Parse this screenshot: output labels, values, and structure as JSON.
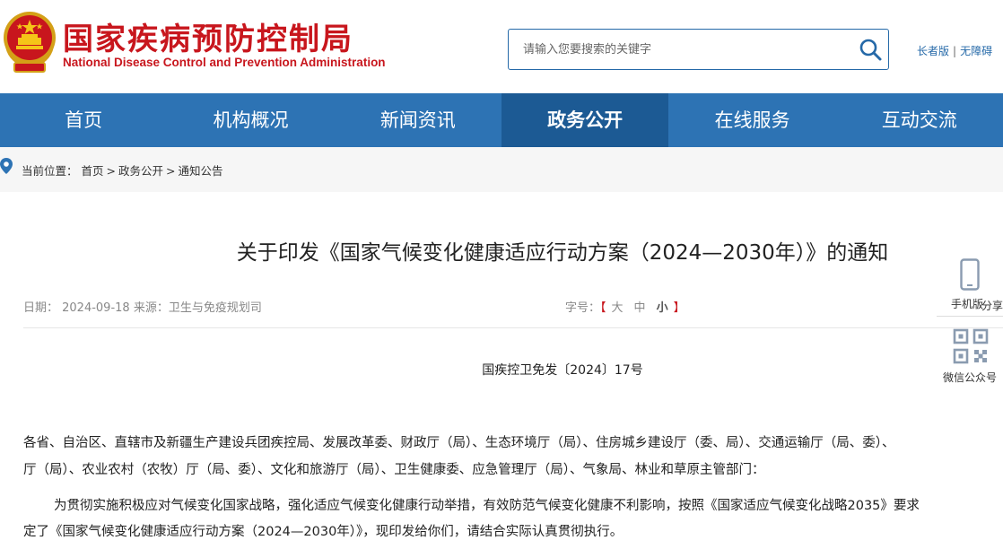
{
  "header": {
    "org_name_cn": "国家疾病预防控制局",
    "org_name_en": "National Disease Control and Prevention Administration",
    "brand_color": "#c8161d",
    "search_placeholder": "请输入您要搜索的关键字",
    "links": {
      "elder": "长者版",
      "separator": "|",
      "accessible": "无障碍"
    }
  },
  "nav": {
    "color": "#2d73b4",
    "active_color": "#1c5a94",
    "items": [
      {
        "label": "首页"
      },
      {
        "label": "机构概况"
      },
      {
        "label": "新闻资讯"
      },
      {
        "label": "政务公开",
        "active": true
      },
      {
        "label": "在线服务"
      },
      {
        "label": "互动交流"
      }
    ]
  },
  "breadcrumb": {
    "prefix": "当前位置：",
    "items": [
      "首页",
      "政务公开",
      "通知公告"
    ],
    "separator": ">"
  },
  "article": {
    "title": "关于印发《国家气候变化健康适应行动方案（2024—2030年）》的通知",
    "meta": "日期：  2024-09-18 来源：卫生与免疫规划司",
    "fontsize_label": "字号：",
    "fontsize_open": "【",
    "fontsize_close": "】",
    "fontsize_options": [
      "大",
      "中",
      "小"
    ],
    "doc_number": "国疾控卫免发〔2024〕17号",
    "paragraphs": [
      "各省、自治区、直辖市及新疆生产建设兵团疾控局、发展改革委、财政厅（局）、生态环境厅（局）、住房城乡建设厅（委、局）、交通运输厅（局、委）、",
      "厅（局）、农业农村（农牧）厅（局、委）、文化和旅游厅（局）、卫生健康委、应急管理厅（局）、气象局、林业和草原主管部门：",
      "为贯彻实施积极应对气候变化国家战略，强化适应气候变化健康行动举措，有效防范气候变化健康不利影响，按照《国家适应气候变化战略2035》要求",
      "定了《国家气候变化健康适应行动方案（2024—2030年）》，现印发给你们，请结合实际认真贯彻执行。"
    ]
  },
  "side": {
    "phone_label": "手机版",
    "share_label": "分享",
    "wechat_label": "微信公众号"
  }
}
